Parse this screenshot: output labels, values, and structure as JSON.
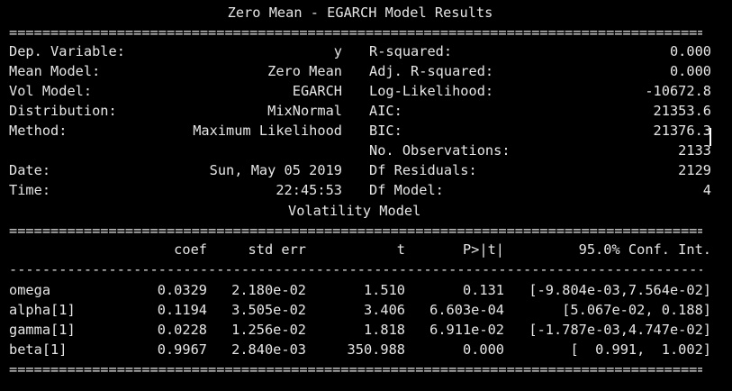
{
  "title": "Zero Mean - EGARCH Model Results",
  "rules": {
    "double": "=============================================================================================================",
    "single": "-------------------------------------------------------------------------------------------------------------"
  },
  "summary": {
    "left": [
      {
        "label": "Dep. Variable:",
        "value": "y"
      },
      {
        "label": "Mean Model:",
        "value": "Zero Mean"
      },
      {
        "label": "Vol Model:",
        "value": "EGARCH"
      },
      {
        "label": "Distribution:",
        "value": "MixNormal"
      },
      {
        "label": "Method:",
        "value": "Maximum Likelihood"
      },
      {
        "label": "",
        "value": ""
      },
      {
        "label": "Date:",
        "value": "Sun, May 05 2019"
      },
      {
        "label": "Time:",
        "value": "22:45:53"
      }
    ],
    "right": [
      {
        "label": "R-squared:",
        "value": "0.000"
      },
      {
        "label": "Adj. R-squared:",
        "value": "0.000"
      },
      {
        "label": "Log-Likelihood:",
        "value": "-10672.8"
      },
      {
        "label": "AIC:",
        "value": "21353.6"
      },
      {
        "label": "BIC:",
        "value": "21376.3"
      },
      {
        "label": "No. Observations:",
        "value": "2133"
      },
      {
        "label": "Df Residuals:",
        "value": "2129"
      },
      {
        "label": "Df Model:",
        "value": "4"
      }
    ]
  },
  "vol_section_title": "Volatility Model",
  "table": {
    "headers": [
      "coef",
      "std err",
      "t",
      "P>|t|",
      "95.0% Conf. Int."
    ],
    "rows": [
      {
        "name": "omega",
        "coef": "0.0329",
        "stderr": "2.180e-02",
        "t": "1.510",
        "p": "0.131",
        "ci": "[-9.804e-03,7.564e-02]"
      },
      {
        "name": "alpha[1]",
        "coef": "0.1194",
        "stderr": "3.505e-02",
        "t": "3.406",
        "p": "6.603e-04",
        "ci": "[5.067e-02, 0.188]"
      },
      {
        "name": "gamma[1]",
        "coef": "0.0228",
        "stderr": "1.256e-02",
        "t": "1.818",
        "p": "6.911e-02",
        "ci": "[-1.787e-03,4.747e-02]"
      },
      {
        "name": "beta[1]",
        "coef": "0.9967",
        "stderr": "2.840e-03",
        "t": "350.988",
        "p": "0.000",
        "ci": "[  0.991,  1.002]"
      }
    ]
  }
}
